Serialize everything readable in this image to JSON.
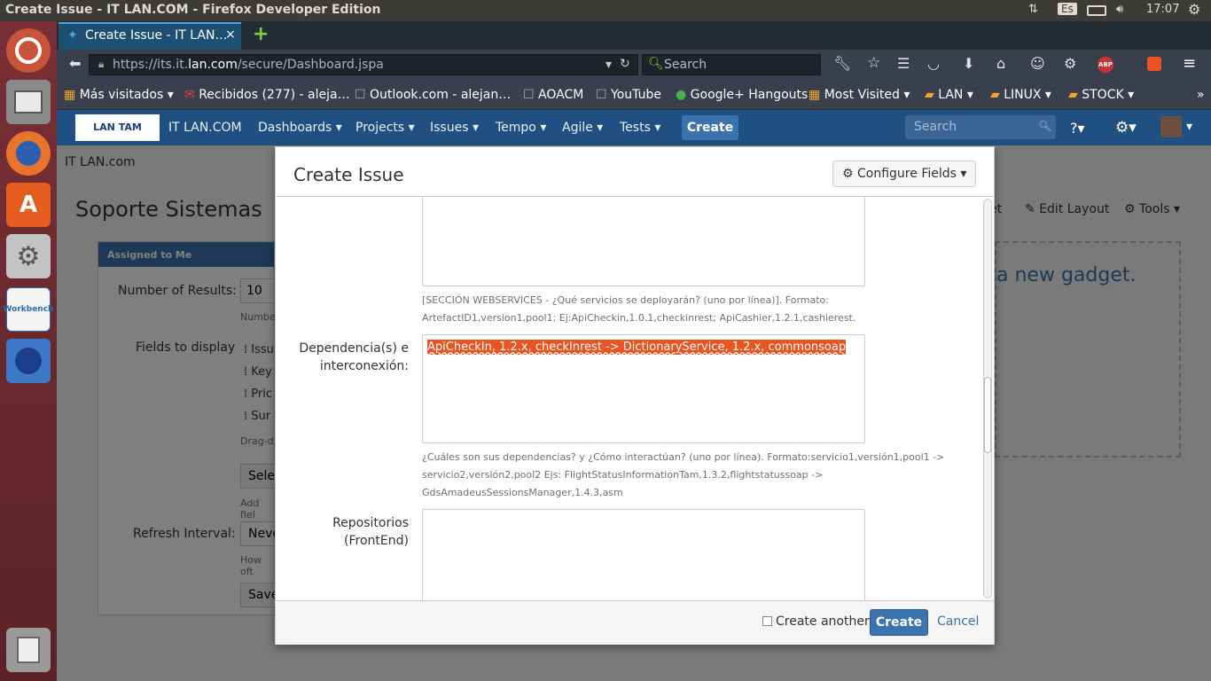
{
  "window_title": "Create Issue - IT LAN.COM - Firefox Developer Edition",
  "panel": {
    "keyboard": "Es",
    "time": "17:07"
  },
  "tab": {
    "label": "Create Issue - IT LAN…",
    "close": "×",
    "new_tab": "+"
  },
  "url": {
    "prefix": "https://its.it.",
    "domain": "lan.com",
    "path": "/secure/Dashboard.jspa"
  },
  "search_placeholder": "Search",
  "bookmarks": [
    {
      "label": "Más visitados ▾"
    },
    {
      "label": "Recibidos (277) - aleja…"
    },
    {
      "label": "Outlook.com - alejan…"
    },
    {
      "label": "AOACM"
    },
    {
      "label": "YouTube"
    },
    {
      "label": "Google+ Hangouts"
    },
    {
      "label": "Most Visited ▾"
    },
    {
      "label": "LAN ▾"
    },
    {
      "label": "LINUX ▾"
    },
    {
      "label": "STOCK ▾"
    }
  ],
  "bookmarks_overflow": "»",
  "jira": {
    "logo": "LAN TAM",
    "site": "IT LAN.COM",
    "nav": [
      "Dashboards ▾",
      "Projects ▾",
      "Issues ▾",
      "Tempo ▾",
      "Agile ▾",
      "Tests ▾"
    ],
    "create": "Create",
    "search_placeholder": "Search"
  },
  "page": {
    "breadcrumb": "IT LAN.com",
    "title": "Soporte Sistemas",
    "edit_layout": "Edit Layout",
    "tools": "Tools ▾",
    "et_fragment": "et",
    "gadget_title": "Assigned to Me",
    "num_results_label": "Number of Results:",
    "num_results_value": "10",
    "num_results_help": "Numbe",
    "fields_label": "Fields to display",
    "fields": [
      "Issu",
      "Key",
      "Pric",
      "Sur"
    ],
    "drag_help": "Drag-d",
    "select": "Selec",
    "add_help": "Add fiel",
    "refresh_label": "Refresh Interval:",
    "refresh_value": "Neve",
    "how_help": "How oft",
    "save": "Save",
    "new_gadget": "a new gadget."
  },
  "dialog": {
    "title": "Create Issue",
    "configure": "Configure Fields ▾",
    "ws_help": "[SECCIÓN WEBSERVICES - ¿Qué servicios se deployarán? (uno por línea)]. Formato:",
    "ws_help2": "ArtefactID1,version1,pool1; Ej:ApiCheckin,1.0.1,checkinrest; ApiCashier,1.2.1,cashierest.",
    "dep_label1": "Dependencia(s) e",
    "dep_label2": "interconexión:",
    "dep_value": "ApiCheckIn, 1.2.x, checkInrest -> DictionaryService, 1.2.x, commonsoap",
    "dep_help1": "¿Cuáles son sus dependencias? y ¿Cómo interactúan? (uno por línea). Formato:servicio1,versión1,pool1 ->",
    "dep_help2": "servicio2,versión2,pool2 Ejs: FlightStatusInformationTam,1.3.2,flightstatussoap ->",
    "dep_help3": "GdsAmadeusSessionsManager,1.4.3,asm",
    "repo_label1": "Repositorios",
    "repo_label2": "(FrontEnd)",
    "create_another": "Create another",
    "create": "Create",
    "cancel": "Cancel"
  }
}
